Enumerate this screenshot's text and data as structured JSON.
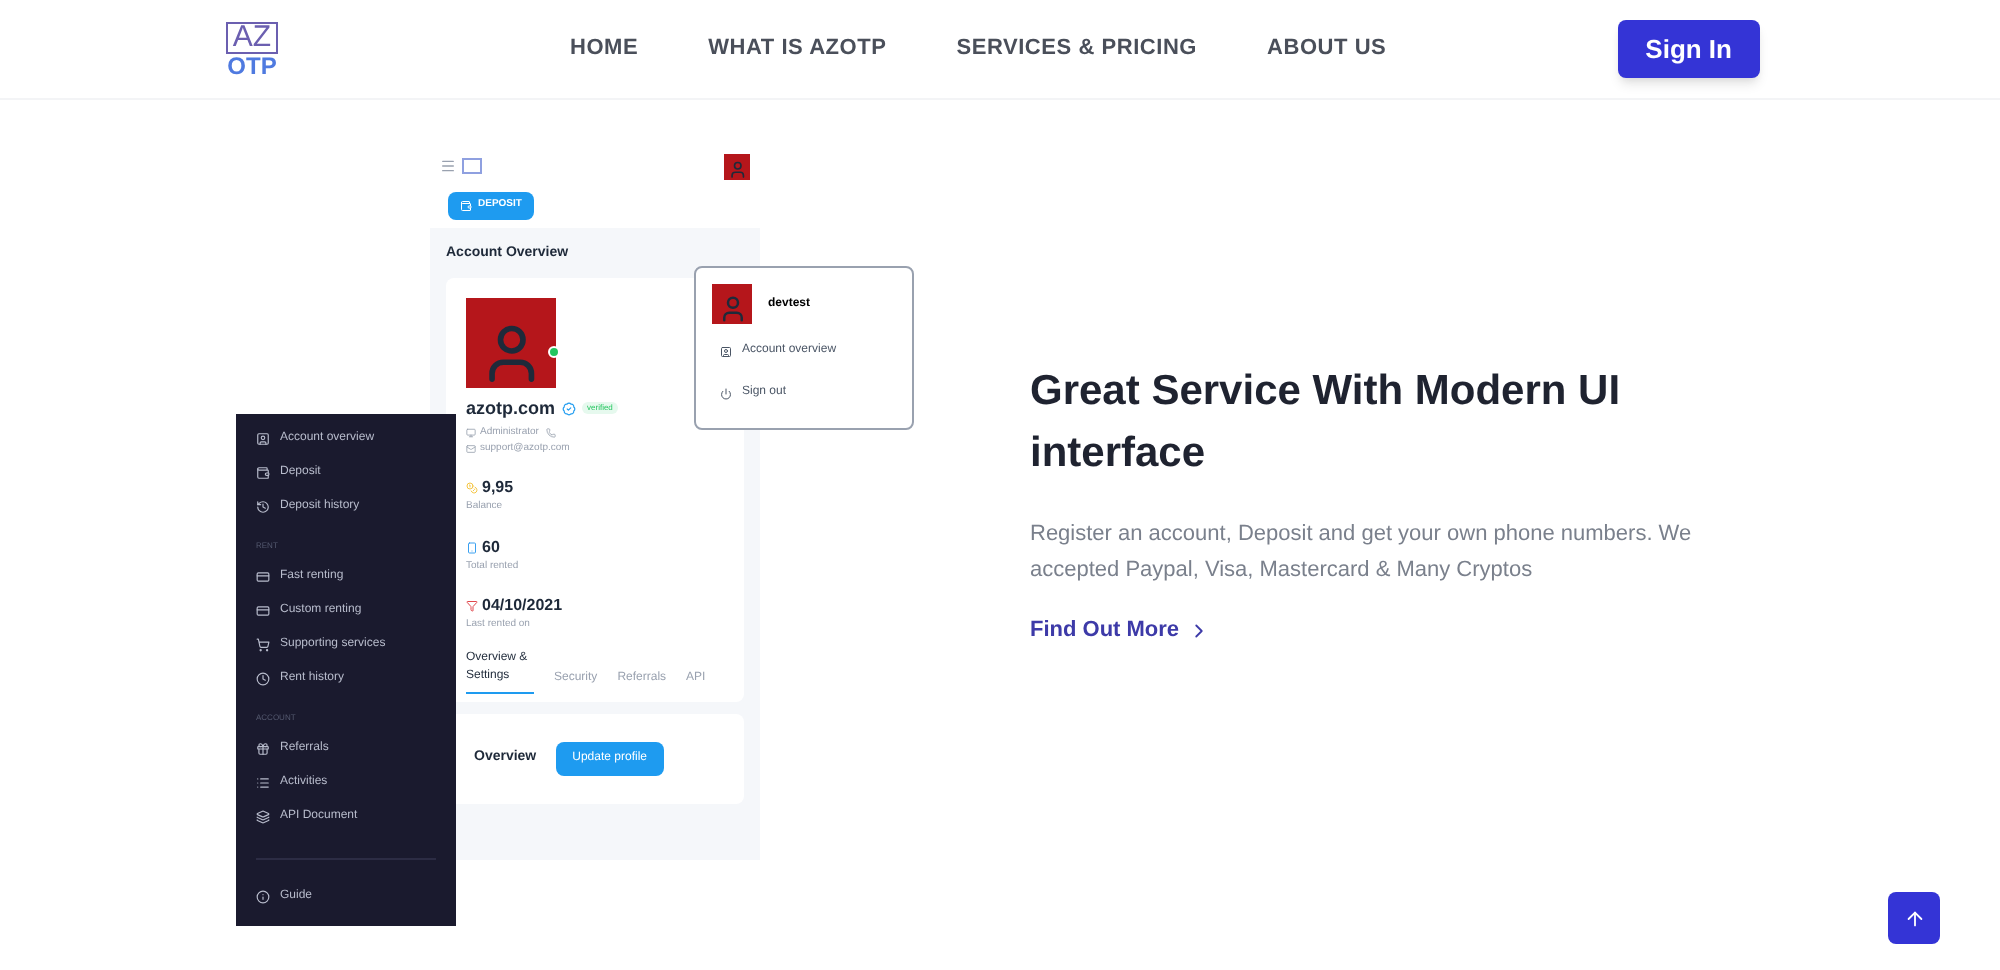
{
  "nav": {
    "logo": {
      "top": "AZ",
      "bottom": "OTP"
    },
    "links": [
      {
        "label": "HOME",
        "selected": false
      },
      {
        "label": "WHAT IS AZOTP",
        "selected": false
      },
      {
        "label": "SERVICES & PRICING",
        "selected": false
      },
      {
        "label": "ABOUT US",
        "selected": false
      }
    ],
    "sign_in": "Sign In"
  },
  "mockup": {
    "deposit_button": "DEPOSIT",
    "heading": "Account Overview",
    "profile": {
      "name": "azotp.com",
      "badge": "verified",
      "role": "Administrator",
      "email": "support@azotp.com",
      "online": true
    },
    "stats": [
      {
        "kind": "coin",
        "value": "9,95",
        "label": "Balance"
      },
      {
        "kind": "phone",
        "value": "60",
        "label": "Total rented"
      },
      {
        "kind": "filter",
        "value": "04/10/2021",
        "label": "Last rented on"
      }
    ],
    "tabs": [
      {
        "label": "Overview & Settings",
        "selected": true
      },
      {
        "label": "Security",
        "selected": false
      },
      {
        "label": "Referrals",
        "selected": false
      },
      {
        "label": "API",
        "selected": false
      }
    ],
    "overview_label": "Overview",
    "update_button": "Update profile",
    "dropdown": {
      "username": "devtest",
      "items": [
        {
          "kind": "account",
          "label": "Account overview"
        },
        {
          "kind": "signout",
          "label": "Sign out"
        }
      ]
    },
    "sidebar": {
      "sections": [
        {
          "items": [
            {
              "kind": "account",
              "label": "Account overview"
            },
            {
              "kind": "deposit",
              "label": "Deposit"
            },
            {
              "kind": "history",
              "label": "Deposit history"
            }
          ]
        },
        {
          "title": "RENT",
          "items": [
            {
              "kind": "sim",
              "label": "Fast renting"
            },
            {
              "kind": "sim",
              "label": "Custom renting"
            },
            {
              "kind": "cart",
              "label": "Supporting services"
            },
            {
              "kind": "clock",
              "label": "Rent history"
            }
          ]
        },
        {
          "title": "ACCOUNT",
          "items": [
            {
              "kind": "gift",
              "label": "Referrals"
            },
            {
              "kind": "list",
              "label": "Activities"
            },
            {
              "kind": "layers",
              "label": "API Document"
            }
          ]
        }
      ],
      "guide": "Guide"
    }
  },
  "hero": {
    "title": "Great Service With Modern UI interface",
    "body": "Register an account, Deposit and get your own phone numbers. We accepted Paypal, Visa, Mastercard & Many Cryptos",
    "link": "Find Out More"
  }
}
